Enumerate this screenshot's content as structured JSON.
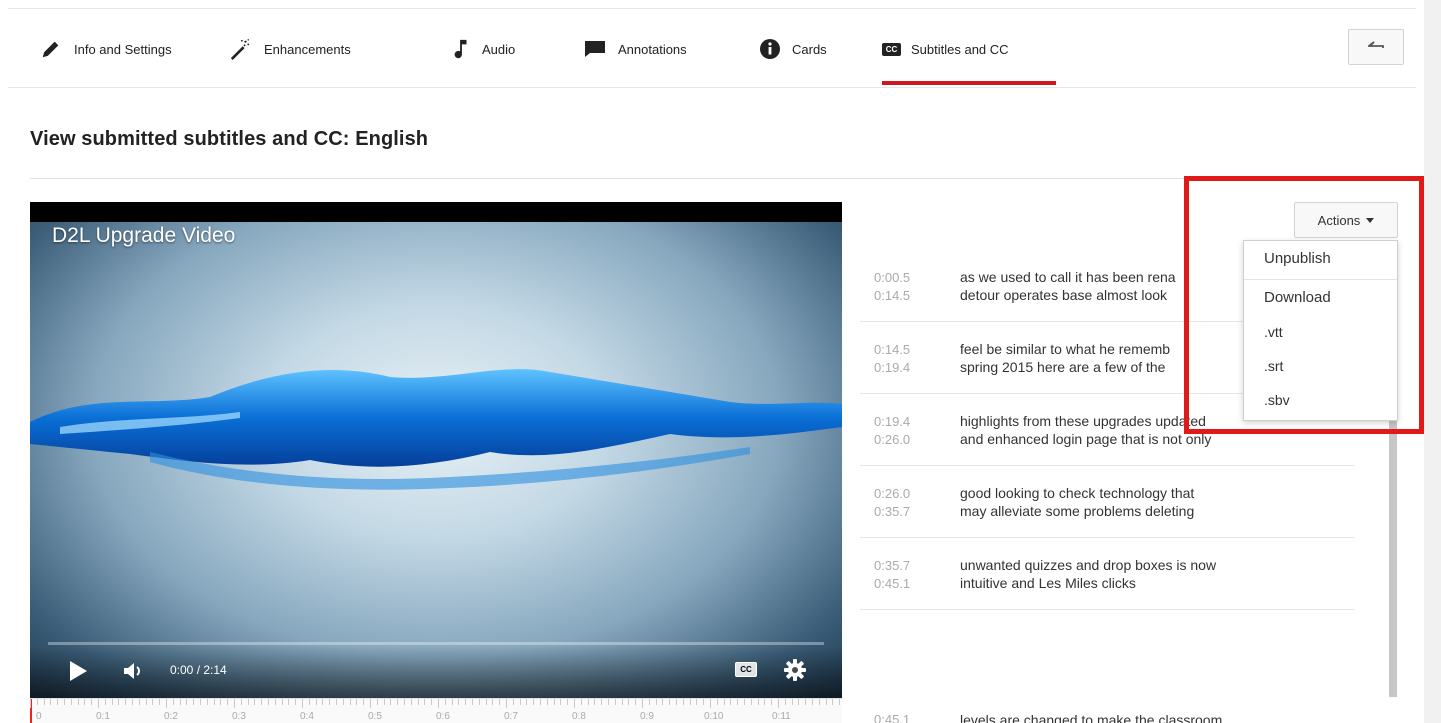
{
  "tabs": [
    {
      "label": "Info and Settings",
      "icon": "pencil-icon"
    },
    {
      "label": "Enhancements",
      "icon": "magic-wand-icon"
    },
    {
      "label": "Audio",
      "icon": "music-note-icon"
    },
    {
      "label": "Annotations",
      "icon": "speech-bubble-icon"
    },
    {
      "label": "Cards",
      "icon": "info-circle-icon"
    },
    {
      "label": "Subtitles and CC",
      "icon": "cc-icon",
      "badge": "CC",
      "active": true
    }
  ],
  "page_title": "View submitted subtitles and CC: English",
  "player": {
    "video_title": "D2L Upgrade Video",
    "time": "0:00 / 2:14",
    "cc_label": "CC"
  },
  "ruler_labels": [
    "0",
    "0:1",
    "0:2",
    "0:3",
    "0:4",
    "0:5",
    "0:6",
    "0:7",
    "0:8",
    "0:9",
    "0:10",
    "0:11"
  ],
  "actions": {
    "label": "Actions",
    "menu": [
      "Unpublish",
      "Download",
      ".vtt",
      ".srt",
      ".sbv"
    ]
  },
  "cues": [
    {
      "start": "0:00.5",
      "end": "0:14.5",
      "line1": "as we used to call it has been rena",
      "line2": "detour operates base almost look"
    },
    {
      "start": "0:14.5",
      "end": "0:19.4",
      "line1": "feel be similar to what he rememb",
      "line2": "spring 2015 here are a few of the"
    },
    {
      "start": "0:19.4",
      "end": "0:26.0",
      "line1": "highlights from these upgrades updated",
      "line2": "and enhanced login page that is not only"
    },
    {
      "start": "0:26.0",
      "end": "0:35.7",
      "line1": "good looking to check technology that",
      "line2": "may alleviate some problems deleting"
    },
    {
      "start": "0:35.7",
      "end": "0:45.1",
      "line1": "unwanted quizzes and drop boxes is now",
      "line2": "intuitive and Les Miles clicks"
    }
  ],
  "cue_tail": {
    "start": "0:45.1",
    "line1": "levels are changed to make the classroom"
  },
  "colors": {
    "accent": "#cc181e",
    "highlight": "#e01919"
  }
}
